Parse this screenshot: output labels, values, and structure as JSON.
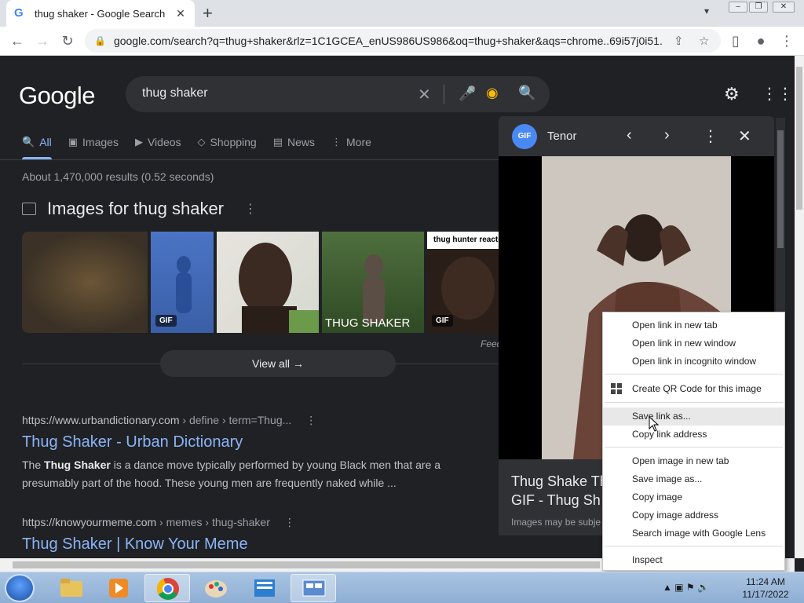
{
  "browser": {
    "tab_title": "thug shaker - Google Search",
    "tab_favicon": "G",
    "url": "google.com/search?q=thug+shaker&rlz=1C1GCEA_enUS986US986&oq=thug+shaker&aqs=chrome..69i57j0i51..."
  },
  "search": {
    "logo": "Google",
    "query": "thug shaker"
  },
  "nav_tabs": [
    {
      "label": "All",
      "icon": "search-icon",
      "active": true
    },
    {
      "label": "Images",
      "icon": "image-icon",
      "active": false
    },
    {
      "label": "Videos",
      "icon": "play-icon",
      "active": false
    },
    {
      "label": "Shopping",
      "icon": "tag-icon",
      "active": false
    },
    {
      "label": "News",
      "icon": "news-icon",
      "active": false
    },
    {
      "label": "More",
      "icon": "more-vert-icon",
      "active": false
    }
  ],
  "stats": "About 1,470,000 results (0.52 seconds)",
  "images_section": {
    "heading": "Images for thug shaker",
    "thumbs": [
      {
        "badge": ""
      },
      {
        "badge": "GIF"
      },
      {
        "badge": ""
      },
      {
        "badge": "",
        "caption": "THUG SHAKER"
      },
      {
        "badge": "GIF",
        "caption": "thug hunter reaction"
      }
    ],
    "feedback": "Feed",
    "view_all": "View all"
  },
  "results": [
    {
      "cite_domain": "https://www.urbandictionary.com",
      "cite_path": " › define › term=Thug...",
      "title": "Thug Shaker - Urban Dictionary",
      "snippet_pre": "The ",
      "snippet_bold": "Thug Shaker",
      "snippet_post": " is a dance move typically performed by young Black men that are a presumably part of the hood. These young men are frequently naked while ..."
    },
    {
      "cite_domain": "https://knowyourmeme.com",
      "cite_path": " › memes › thug-shaker",
      "title": "Thug Shaker | Know Your Meme"
    }
  ],
  "preview": {
    "source": "Tenor",
    "source_logo": "GIF",
    "title_line1": "Thug Shake Th",
    "title_line2": "GIF - Thug Sh",
    "caption": "Images may be subje"
  },
  "context_menu": {
    "items": [
      {
        "label": "Open link in new tab"
      },
      {
        "label": "Open link in new window"
      },
      {
        "label": "Open link in incognito window"
      },
      {
        "label": "Create QR Code for this image"
      },
      {
        "label": "Save link as..."
      },
      {
        "label": "Copy link address"
      },
      {
        "label": "Open image in new tab"
      },
      {
        "label": "Save image as..."
      },
      {
        "label": "Copy image"
      },
      {
        "label": "Copy image address"
      },
      {
        "label": "Search image with Google Lens"
      },
      {
        "label": "Inspect"
      }
    ],
    "highlighted": "Save link as..."
  },
  "taskbar": {
    "time": "11:24 AM",
    "date": "11/17/2022"
  },
  "colors": {
    "page_bg": "#202124",
    "link_blue": "#8ab4f8",
    "text": "#e8eaed",
    "muted": "#9aa0a6"
  }
}
